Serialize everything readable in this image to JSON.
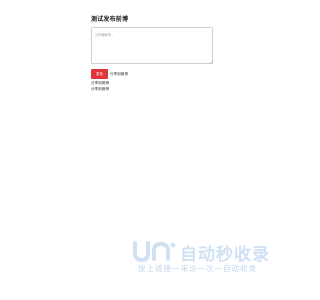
{
  "form": {
    "title": "测试发布前博",
    "textarea_placeholder": "分享新鲜事…",
    "textarea_value": "",
    "submit_label": "发布"
  },
  "share": {
    "inline_label": "分享到微博",
    "extra_lines": [
      "分享到微博",
      "分享到微博"
    ]
  },
  "watermark": {
    "name": "自动秒收录",
    "slogan": "放上链接一来访一次一自动收录",
    "color": "#cfe1f2"
  },
  "colors": {
    "submit_bg": "#e2353a",
    "submit_text": "#ffffff",
    "textarea_border": "#cfcfcf"
  }
}
